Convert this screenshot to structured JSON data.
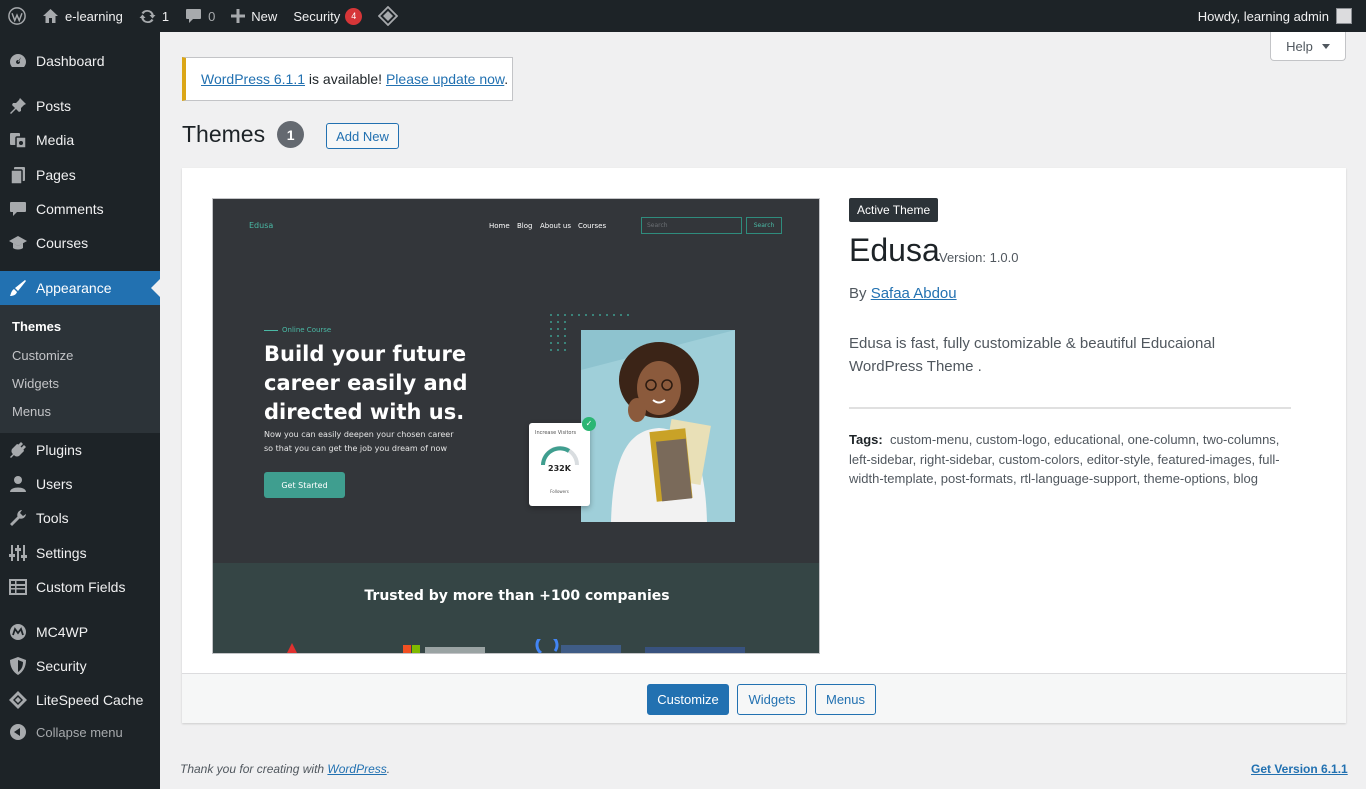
{
  "adminbar": {
    "site_name": "e-learning",
    "updates_count": "1",
    "comments_count": "0",
    "new_label": "New",
    "security_label": "Security",
    "security_badge": "4",
    "howdy": "Howdy, learning admin"
  },
  "sidebar": {
    "items": [
      {
        "label": "Dashboard",
        "icon": "dashboard-icon"
      },
      {
        "label": "Posts",
        "icon": "pin-icon"
      },
      {
        "label": "Media",
        "icon": "media-icon"
      },
      {
        "label": "Pages",
        "icon": "pages-icon"
      },
      {
        "label": "Comments",
        "icon": "comment-icon"
      },
      {
        "label": "Courses",
        "icon": "graduation-cap-icon"
      },
      {
        "label": "Appearance",
        "icon": "brush-icon"
      },
      {
        "label": "Plugins",
        "icon": "plug-icon"
      },
      {
        "label": "Users",
        "icon": "user-icon"
      },
      {
        "label": "Tools",
        "icon": "wrench-icon"
      },
      {
        "label": "Settings",
        "icon": "sliders-icon"
      },
      {
        "label": "Custom Fields",
        "icon": "table-icon"
      },
      {
        "label": "MC4WP",
        "icon": "mc4wp-icon"
      },
      {
        "label": "Security",
        "icon": "shield-icon"
      },
      {
        "label": "LiteSpeed Cache",
        "icon": "diamond-icon"
      }
    ],
    "submenu": [
      "Themes",
      "Customize",
      "Widgets",
      "Menus"
    ],
    "collapse": "Collapse menu"
  },
  "help_label": "Help",
  "notice": {
    "link1": "WordPress 6.1.1",
    "middle": " is available! ",
    "link2": "Please update now",
    "end": "."
  },
  "page": {
    "title": "Themes",
    "count": "1",
    "add_new": "Add New"
  },
  "theme": {
    "active_label": "Active Theme",
    "name": "Edusa",
    "version": "Version: 1.0.0",
    "by": "By ",
    "author": "Safaa Abdou",
    "description": "Edusa is fast, fully customizable & beautiful Educaional WordPress Theme .",
    "tags_label": "Tags:",
    "tags": "custom-menu, custom-logo, educational, one-column, two-columns, left-sidebar, right-sidebar, custom-colors, editor-style, featured-images, full-width-template, post-formats, rtl-language-support, theme-options, blog",
    "buttons": {
      "customize": "Customize",
      "widgets": "Widgets",
      "menus": "Menus"
    }
  },
  "screenshot": {
    "logo": "Edusa",
    "nav": [
      "Home",
      "Blog",
      "About us",
      "Courses"
    ],
    "search_placeholder": "Search",
    "search_button": "Search",
    "eyebrow": "Online Course",
    "headline": [
      "Build your future",
      "career easily and",
      "directed with us."
    ],
    "subtext": [
      "Now you can easily deepen your chosen career",
      "so that you can get the job you dream of now"
    ],
    "cta": "Get Started",
    "visitors_label": "Increase Visitors",
    "visitors_value": "232K",
    "followers_label": "Followers",
    "trusted": "Trusted by more than +100 companies"
  },
  "footer": {
    "thanks": "Thank you for creating with ",
    "wordpress": "WordPress",
    "period": ".",
    "version": "Get Version 6.1.1"
  },
  "colors": {
    "adminbar": "#1d2327",
    "accent": "#2271b1",
    "notice": "#dba617",
    "badge": "#d63638",
    "teal": "#3f9e8f"
  }
}
